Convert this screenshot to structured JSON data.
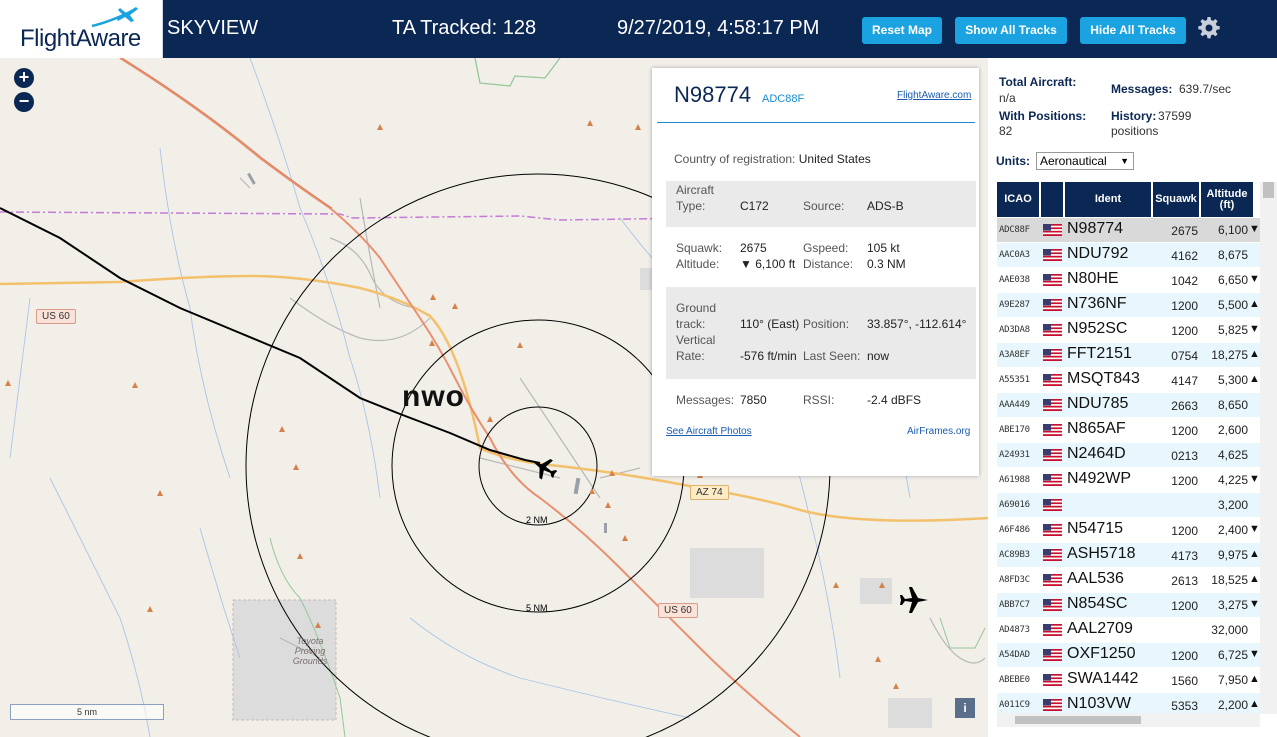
{
  "header": {
    "logo_text": "FlightAware",
    "site_name": "SKYVIEW",
    "tracked": "TA Tracked: 128",
    "datetime": "9/27/2019, 4:58:17 PM",
    "buttons": {
      "reset": "Reset Map",
      "show": "Show All Tracks",
      "hide": "Hide All Tracks"
    },
    "settings_icon": "gear-icon"
  },
  "map": {
    "zoom_in": "+",
    "zoom_out": "−",
    "site_label": "nwo",
    "ring_labels": [
      "2 NM",
      "5 NM"
    ],
    "roads": {
      "us60_a": "US 60",
      "us60_b": "US 60",
      "az74": "AZ 74"
    },
    "poi": "Toyota Proving Grounds",
    "scale": "5 nm",
    "info": "i",
    "colors": {
      "ocean": "#f2efe9",
      "track": "#000000",
      "highway": "#e8906e",
      "state_route": "#f3c06b"
    }
  },
  "popup": {
    "ident": "N98774",
    "icao": "ADC88F",
    "link_top": "FlightAware.com",
    "country_label": "Country of registration:",
    "country": "United States",
    "aircraft_type_label": "Aircraft Type:",
    "aircraft_type": "C172",
    "source_label": "Source:",
    "source": "ADS-B",
    "squawk_label": "Squawk:",
    "squawk": "2675",
    "altitude_label": "Altitude:",
    "altitude": "▼ 6,100 ft",
    "gspeed_label": "Gspeed:",
    "gspeed": "105 kt",
    "distance_label": "Distance:",
    "distance": "0.3 NM",
    "track_label": "Ground track:",
    "track": "110° (East)",
    "vrate_label": "Vertical Rate:",
    "vrate": "-576 ft/min",
    "position_label": "Position:",
    "position": "33.857°, -112.614°",
    "lastseen_label": "Last Seen:",
    "lastseen": "now",
    "messages_label": "Messages:",
    "messages": "7850",
    "rssi_label": "RSSI:",
    "rssi": "-2.4 dBFS",
    "link_photos": "See Aircraft Photos",
    "link_airframes": "AirFrames.org"
  },
  "panel": {
    "total_label": "Total Aircraft:",
    "total_value": "n/a",
    "messages_label": "Messages:",
    "messages_value": "639.7/sec",
    "withpos_label": "With Positions:",
    "withpos_value": "82",
    "history_label": "History:",
    "history_value": "37599 positions",
    "units_label": "Units:",
    "units_value": "Aeronautical",
    "columns": [
      "ICAO",
      "",
      "Ident",
      "Squawk",
      "Altitude (ft)"
    ],
    "rows": [
      {
        "icao": "ADC88F",
        "ident": "N98774",
        "squawk": "2675",
        "alt": "6,100",
        "trend": "▼"
      },
      {
        "icao": "AAC0A3",
        "ident": "NDU792",
        "squawk": "4162",
        "alt": "8,675",
        "trend": ""
      },
      {
        "icao": "AAE038",
        "ident": "N80HE",
        "squawk": "1042",
        "alt": "6,650",
        "trend": "▼"
      },
      {
        "icao": "A9E287",
        "ident": "N736NF",
        "squawk": "1200",
        "alt": "5,500",
        "trend": "▲"
      },
      {
        "icao": "AD3DA8",
        "ident": "N952SC",
        "squawk": "1200",
        "alt": "5,825",
        "trend": "▼"
      },
      {
        "icao": "A3A8EF",
        "ident": "FFT2151",
        "squawk": "0754",
        "alt": "18,275",
        "trend": "▲"
      },
      {
        "icao": "A55351",
        "ident": "MSQT843",
        "squawk": "4147",
        "alt": "5,300",
        "trend": "▲"
      },
      {
        "icao": "AAA449",
        "ident": "NDU785",
        "squawk": "2663",
        "alt": "8,650",
        "trend": ""
      },
      {
        "icao": "ABE170",
        "ident": "N865AF",
        "squawk": "1200",
        "alt": "2,600",
        "trend": ""
      },
      {
        "icao": "A24931",
        "ident": "N2464D",
        "squawk": "0213",
        "alt": "4,625",
        "trend": ""
      },
      {
        "icao": "A61988",
        "ident": "N492WP",
        "squawk": "1200",
        "alt": "4,225",
        "trend": "▼"
      },
      {
        "icao": "A69016",
        "ident": "",
        "squawk": "",
        "alt": "3,200",
        "trend": ""
      },
      {
        "icao": "A6F486",
        "ident": "N54715",
        "squawk": "1200",
        "alt": "2,400",
        "trend": "▼"
      },
      {
        "icao": "AC89B3",
        "ident": "ASH5718",
        "squawk": "4173",
        "alt": "9,975",
        "trend": "▲"
      },
      {
        "icao": "A8FD3C",
        "ident": "AAL536",
        "squawk": "2613",
        "alt": "18,525",
        "trend": "▲"
      },
      {
        "icao": "ABB7C7",
        "ident": "N854SC",
        "squawk": "1200",
        "alt": "3,275",
        "trend": "▼"
      },
      {
        "icao": "AD4873",
        "ident": "AAL2709",
        "squawk": "",
        "alt": "32,000",
        "trend": ""
      },
      {
        "icao": "A54DAD",
        "ident": "OXF1250",
        "squawk": "1200",
        "alt": "6,725",
        "trend": "▼"
      },
      {
        "icao": "ABEBE0",
        "ident": "SWA1442",
        "squawk": "1560",
        "alt": "7,950",
        "trend": "▲"
      },
      {
        "icao": "A011C9",
        "ident": "N103VW",
        "squawk": "5353",
        "alt": "2,200",
        "trend": "▲"
      }
    ],
    "colors": {
      "header": "#0b2754",
      "row_selected": "#d9d9d9",
      "row_a": "#ffffff",
      "row_b": "#e8f7fd"
    }
  }
}
